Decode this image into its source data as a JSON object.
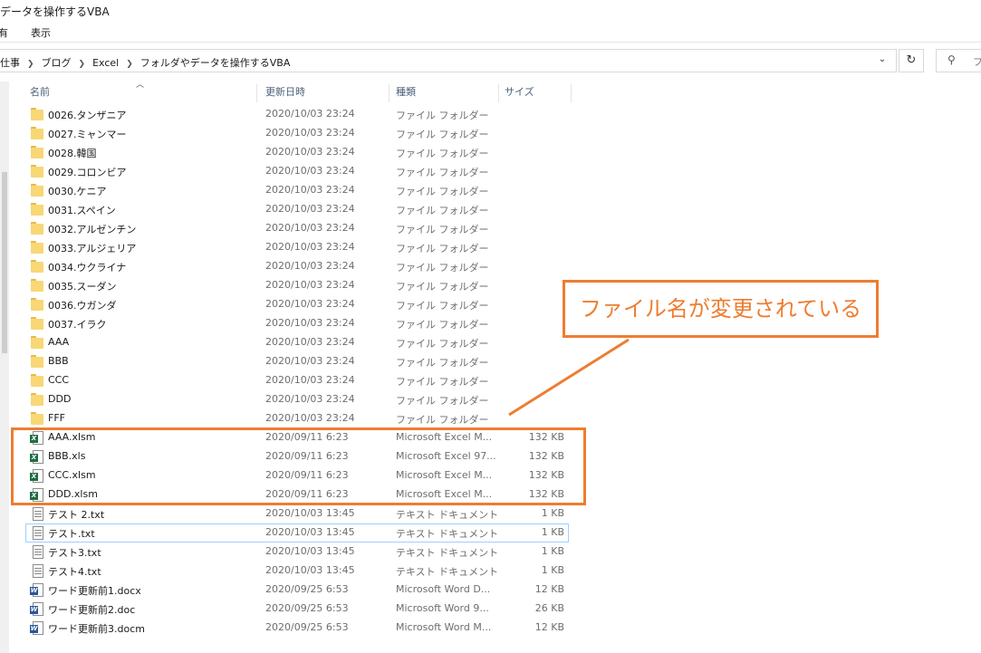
{
  "window": {
    "title": "データを操作するVBA"
  },
  "ribbon": {
    "tabs": [
      "有",
      "表示"
    ]
  },
  "address": {
    "crumbs": [
      "仕事",
      "ブログ",
      "Excel",
      "フォルダやデータを操作するVBA"
    ],
    "search_placeholder": "フ"
  },
  "columns": {
    "name": "名前",
    "date": "更新日時",
    "type": "種類",
    "size": "サイズ"
  },
  "files": [
    {
      "name": "0026.タンザニア",
      "date": "2020/10/03 23:24",
      "type": "ファイル フォルダー",
      "size": "",
      "icon": "folder-icon"
    },
    {
      "name": "0027.ミャンマー",
      "date": "2020/10/03 23:24",
      "type": "ファイル フォルダー",
      "size": "",
      "icon": "folder-icon"
    },
    {
      "name": "0028.韓国",
      "date": "2020/10/03 23:24",
      "type": "ファイル フォルダー",
      "size": "",
      "icon": "folder-icon"
    },
    {
      "name": "0029.コロンビア",
      "date": "2020/10/03 23:24",
      "type": "ファイル フォルダー",
      "size": "",
      "icon": "folder-icon"
    },
    {
      "name": "0030.ケニア",
      "date": "2020/10/03 23:24",
      "type": "ファイル フォルダー",
      "size": "",
      "icon": "folder-icon"
    },
    {
      "name": "0031.スペイン",
      "date": "2020/10/03 23:24",
      "type": "ファイル フォルダー",
      "size": "",
      "icon": "folder-icon"
    },
    {
      "name": "0032.アルゼンチン",
      "date": "2020/10/03 23:24",
      "type": "ファイル フォルダー",
      "size": "",
      "icon": "folder-icon"
    },
    {
      "name": "0033.アルジェリア",
      "date": "2020/10/03 23:24",
      "type": "ファイル フォルダー",
      "size": "",
      "icon": "folder-icon"
    },
    {
      "name": "0034.ウクライナ",
      "date": "2020/10/03 23:24",
      "type": "ファイル フォルダー",
      "size": "",
      "icon": "folder-icon"
    },
    {
      "name": "0035.スーダン",
      "date": "2020/10/03 23:24",
      "type": "ファイル フォルダー",
      "size": "",
      "icon": "folder-icon"
    },
    {
      "name": "0036.ウガンダ",
      "date": "2020/10/03 23:24",
      "type": "ファイル フォルダー",
      "size": "",
      "icon": "folder-icon"
    },
    {
      "name": "0037.イラク",
      "date": "2020/10/03 23:24",
      "type": "ファイル フォルダー",
      "size": "",
      "icon": "folder-icon"
    },
    {
      "name": "AAA",
      "date": "2020/10/03 23:24",
      "type": "ファイル フォルダー",
      "size": "",
      "icon": "folder-icon"
    },
    {
      "name": "BBB",
      "date": "2020/10/03 23:24",
      "type": "ファイル フォルダー",
      "size": "",
      "icon": "folder-icon"
    },
    {
      "name": "CCC",
      "date": "2020/10/03 23:24",
      "type": "ファイル フォルダー",
      "size": "",
      "icon": "folder-icon"
    },
    {
      "name": "DDD",
      "date": "2020/10/03 23:24",
      "type": "ファイル フォルダー",
      "size": "",
      "icon": "folder-icon"
    },
    {
      "name": "FFF",
      "date": "2020/10/03 23:24",
      "type": "ファイル フォルダー",
      "size": "",
      "icon": "folder-icon"
    },
    {
      "name": "AAA.xlsm",
      "date": "2020/09/11 6:23",
      "type": "Microsoft Excel M...",
      "size": "132 KB",
      "icon": "excel-icon"
    },
    {
      "name": "BBB.xls",
      "date": "2020/09/11 6:23",
      "type": "Microsoft Excel 97...",
      "size": "132 KB",
      "icon": "excel-icon"
    },
    {
      "name": "CCC.xlsm",
      "date": "2020/09/11 6:23",
      "type": "Microsoft Excel M...",
      "size": "132 KB",
      "icon": "excel-icon"
    },
    {
      "name": "DDD.xlsm",
      "date": "2020/09/11 6:23",
      "type": "Microsoft Excel M...",
      "size": "132 KB",
      "icon": "excel-icon"
    },
    {
      "name": "テスト 2.txt",
      "date": "2020/10/03 13:45",
      "type": "テキスト ドキュメント",
      "size": "1 KB",
      "icon": "text-file-icon"
    },
    {
      "name": "テスト.txt",
      "date": "2020/10/03 13:45",
      "type": "テキスト ドキュメント",
      "size": "1 KB",
      "icon": "text-file-icon",
      "focused": true
    },
    {
      "name": "テスト3.txt",
      "date": "2020/10/03 13:45",
      "type": "テキスト ドキュメント",
      "size": "1 KB",
      "icon": "text-file-icon"
    },
    {
      "name": "テスト4.txt",
      "date": "2020/10/03 13:45",
      "type": "テキスト ドキュメント",
      "size": "1 KB",
      "icon": "text-file-icon"
    },
    {
      "name": "ワード更新前1.docx",
      "date": "2020/09/25 6:53",
      "type": "Microsoft Word D...",
      "size": "12 KB",
      "icon": "word-icon"
    },
    {
      "name": "ワード更新前2.doc",
      "date": "2020/09/25 6:53",
      "type": "Microsoft Word 9...",
      "size": "26 KB",
      "icon": "word-icon"
    },
    {
      "name": "ワード更新前3.docm",
      "date": "2020/09/25 6:53",
      "type": "Microsoft Word M...",
      "size": "12 KB",
      "icon": "word-icon"
    }
  ],
  "annotation": {
    "text": "ファイル名が変更されている",
    "color": "#ed7d31"
  },
  "colors": {
    "accent": "#ed7d31",
    "folder": "#f8d775",
    "excel": "#1d6f42",
    "word": "#2b5797",
    "header_text": "#4c607a"
  }
}
